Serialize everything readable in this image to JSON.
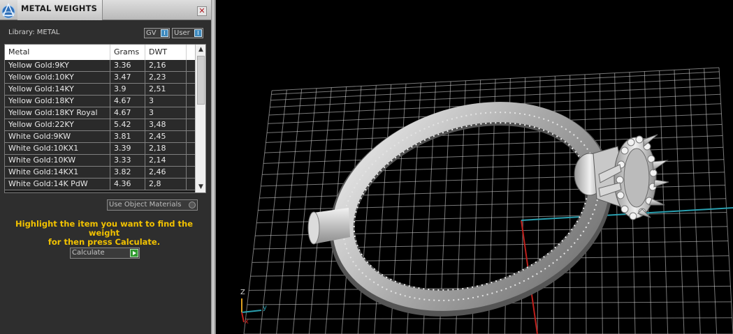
{
  "panel": {
    "title": "METAL WEIGHTS",
    "close_label": "✕",
    "library_label": "Library: METAL",
    "toggles": [
      {
        "label": "GV",
        "indicator": "I"
      },
      {
        "label": "User",
        "indicator": "I"
      }
    ],
    "table": {
      "headers": [
        "Metal",
        "Grams",
        "DWT"
      ],
      "rows": [
        [
          "Yellow Gold:9KY",
          "3.36",
          "2,16"
        ],
        [
          "Yellow Gold:10KY",
          "3.47",
          "2,23"
        ],
        [
          "Yellow Gold:14KY",
          "3.9",
          "2,51"
        ],
        [
          "Yellow Gold:18KY",
          "4.67",
          "3"
        ],
        [
          "Yellow Gold:18KY Royal",
          "4.67",
          "3"
        ],
        [
          "Yellow Gold:22KY",
          "5.42",
          "3,48"
        ],
        [
          "White Gold:9KW",
          "3.81",
          "2,45"
        ],
        [
          "White Gold:10KX1",
          "3.39",
          "2,18"
        ],
        [
          "White Gold:10KW",
          "3.33",
          "2,14"
        ],
        [
          "White Gold:14KX1",
          "3.82",
          "2,46"
        ],
        [
          "White Gold:14K PdW",
          "4.36",
          "2,8"
        ]
      ]
    },
    "use_object_materials": "Use Object Materials",
    "instruction_line1": "Highlight the item you want to find the weight",
    "instruction_line2": "for then press Calculate.",
    "calculate_label": "Calculate",
    "instruction_color": "#f2c200"
  },
  "viewport": {
    "axis_labels": {
      "z": "Z",
      "y": "y",
      "x": "x"
    },
    "colors": {
      "grid": "#d8d8d8",
      "x_axis": "#c0201c",
      "y_axis": "#2aa0b0",
      "z_axis": "#e0a020"
    }
  }
}
